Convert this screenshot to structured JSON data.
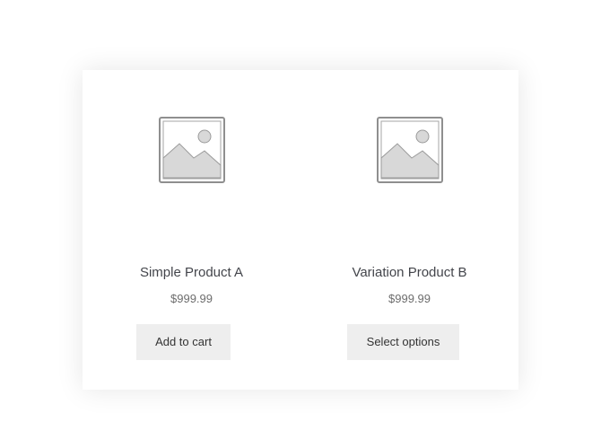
{
  "colors": {
    "card_background": "#ffffff",
    "button_background": "#eeeeee",
    "title_text": "#43454b",
    "price_text": "#6d6d6d",
    "placeholder_fill": "#d8d8d8",
    "placeholder_stroke": "#8f8f8f"
  },
  "products": [
    {
      "icon": "image-placeholder-icon",
      "title": "Simple Product A",
      "price": "$999.99",
      "button_label": "Add to cart"
    },
    {
      "icon": "image-placeholder-icon",
      "title": "Variation Product B",
      "price": "$999.99",
      "button_label": "Select options"
    }
  ]
}
